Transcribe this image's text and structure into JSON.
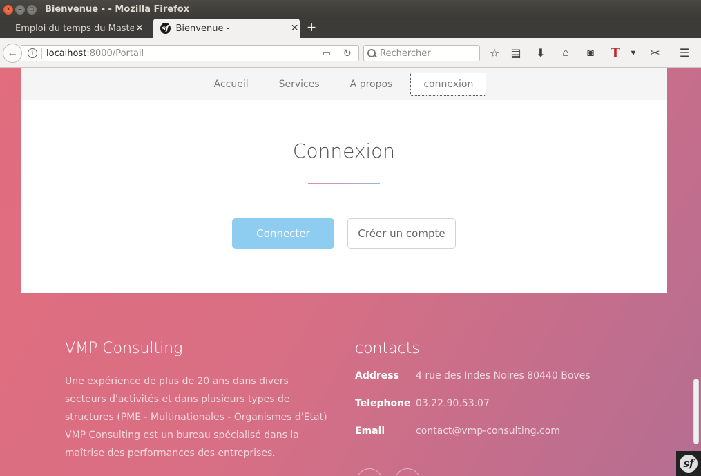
{
  "window": {
    "title": "Bienvenue - - Mozilla Firefox"
  },
  "tabs": [
    {
      "label": "Emploi du temps du Master GI",
      "active": false
    },
    {
      "label": "Bienvenue -",
      "active": true
    }
  ],
  "navbar": {
    "url_host": "localhost",
    "url_path": ":8000/Portail",
    "search_placeholder": "Rechercher"
  },
  "site_menu": {
    "items": [
      "Accueil",
      "Services",
      "A propos",
      "connexion"
    ],
    "active": "connexion"
  },
  "login": {
    "title": "Connexion",
    "primary_button": "Connecter",
    "secondary_button": "Créer un compte"
  },
  "footer": {
    "company": {
      "heading": "VMP Consulting",
      "description_1": "Une expérience de plus de 20 ans dans divers secteurs d'activités et dans plusieurs types de structures (PME - Multinationales - Organismes d'Etat)",
      "description_2": "VMP Consulting est un bureau spécialisé dans la maîtrise des performances des entreprises."
    },
    "contacts": {
      "heading": "contacts",
      "rows": [
        {
          "label": "Address",
          "value": "4 rue des Indes Noires 80440 Boves"
        },
        {
          "label": "Telephone",
          "value": "03.22.90.53.07"
        },
        {
          "label": "Email",
          "value": "contact@vmp-consulting.com"
        }
      ]
    }
  },
  "colors": {
    "page_gradient_start": "#e16d7e",
    "page_gradient_end": "#b56e91",
    "primary_button": "#8fcdf0"
  }
}
